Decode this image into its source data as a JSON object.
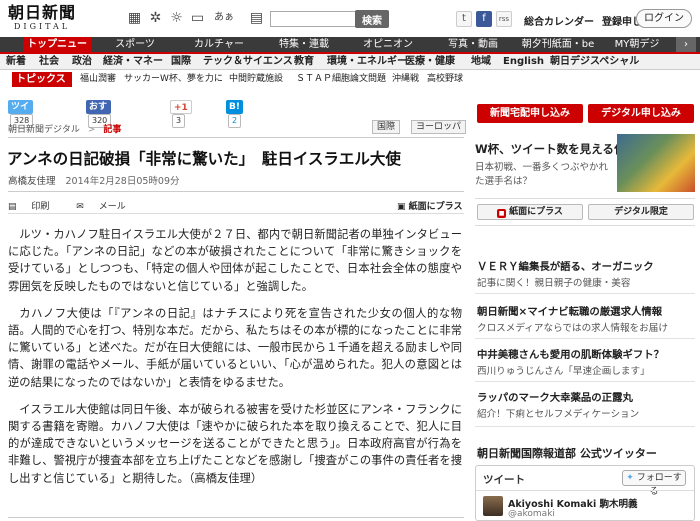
{
  "header": {
    "logo_line1": "朝日新聞",
    "logo_line2": "DIGITAL",
    "search_placeholder": "",
    "search_button": "検索",
    "icon_labels": {
      "ah": "あぁ"
    },
    "links": [
      "総合カレンダー",
      "登録申し込み"
    ],
    "login": "ログイン",
    "social": {
      "twitter": "t",
      "facebook": "f",
      "rss": "rss",
      "gplus": "g+"
    }
  },
  "nav1": [
    "トップニュース",
    "スポーツ",
    "カルチャー",
    "特集・連載",
    "オピニオン",
    "写真・動画",
    "朝夕刊紙面・be",
    "MY朝デジ"
  ],
  "nav2": [
    "新着",
    "社会",
    "政治",
    "経済・マネー",
    "国際",
    "テック＆サイエンス",
    "教育",
    "環境・エネルギー",
    "医療・健康",
    "地域",
    "English",
    "朝日デジスペシャル"
  ],
  "topics": {
    "label": "トピックス",
    "items": [
      "福山潤審",
      "サッカーW杯、夢を力に",
      "中間貯蔵施設",
      "ＳＴＡＰ細胞論文問題",
      "沖縄戦",
      "高校野球"
    ]
  },
  "share": {
    "tweet_label": "ツイート",
    "tweet_count": "328",
    "fb_label": "おすすめ",
    "fb_count": "320",
    "gplus_label": "+1",
    "gplus_count": "3",
    "hatena_label": "B!",
    "hatena_count": "2"
  },
  "crumbs": {
    "home": "朝日新聞デジタル",
    "sep": ">",
    "current": "記事"
  },
  "tags": [
    "国際",
    "ヨーロッパ"
  ],
  "article": {
    "title": "アンネの日記破損「非常に驚いた」　駐日イスラエル大使",
    "author": "高橋友佳理",
    "datetime": "2014年2月28日05時09分",
    "tools": {
      "print": "印刷",
      "mail": "メール",
      "paper": "紙面にプラス"
    },
    "paragraphs": [
      "ルツ・カハノフ駐日イスラエル大使が２７日、都内で朝日新聞記者の単独インタビューに応じた。「アンネの日記」などの本が破損されたことについて「非常に驚きショックを受けている」としつつも、「特定の個人や団体が起こしたことで、日本社会全体の態度や雰囲気を反映したものではないと信じている」と強調した。",
      "カハノフ大使は「『アンネの日記』はナチスにより死を宣告された少女の個人的な物語。人間的で心を打つ、特別な本だ。だから、私たちはその本が標的になったことに非常に驚いている」と述べた。だが在日大使館には、一般市民から１千通を超える励ましや同情、謝罪の電話やメール、手紙が届いているといい、「心が温められた。犯人の意図とは逆の結果になったのではないか」と表情をゆるませた。",
      "イスラエル大使館は同日午後、本が破られる被害を受けた杉並区にアンネ・フランクに関する書籍を寄贈。カハノフ大使は「速やかに破られた本を取り換えることで、犯人に目的が達成できないというメッセージを送ることができたと思う」。日本政府高官が行為を非難し、警視庁が捜査本部を立ち上げたことなどを感謝し「捜査がこの事件の責任者を捜し出すと信じている」と期待した。（高橋友佳理）"
    ]
  },
  "right": {
    "btn_apply": "新聞宅配申し込み",
    "btn_digital": "デジタル申し込み",
    "feature": {
      "title": "W杯、ツイート数を見える化",
      "desc": "日本初戦、一番多くつぶやかれた選手名は？"
    },
    "btn_paper": "紙面にプラス",
    "btn_limited": "デジタル限定",
    "promos": [
      {
        "title": "ＶＥＲＹ編集長が語る、オーガニック",
        "sub": "記事に関く！親日親子の健康・美容"
      },
      {
        "title": "朝日新聞×マイナビ転職の厳選求人情報",
        "sub": "クロスメディアならではの求人情報をお届け"
      },
      {
        "title": "中井美穂さんも愛用の肌断体験ギフト？",
        "sub": "西川りゅうじんさん「早速企画します」"
      },
      {
        "title": "ラッパのマーク大幸薬品の正露丸",
        "sub": "紹介！下痢とセルフメディケーション"
      }
    ],
    "twitter_heading": "朝日新聞国際報道部 公式ツイッター",
    "twitter_box": {
      "label": "ツイート",
      "follow": "フォローする",
      "name": "Akiyoshi Komaki 駒木明義",
      "handle": "@akomaki"
    }
  }
}
